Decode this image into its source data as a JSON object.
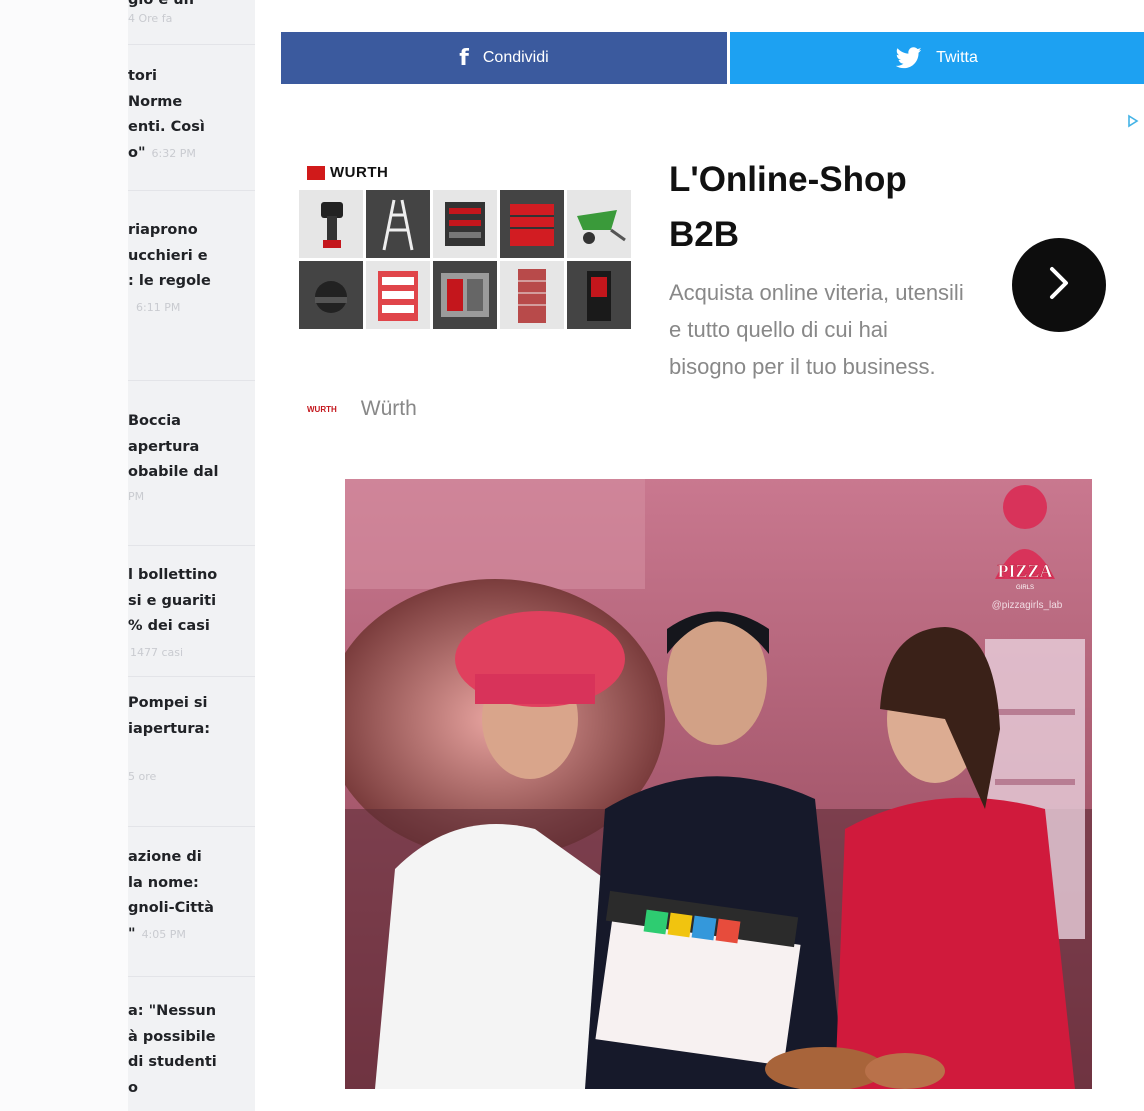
{
  "sidebar": {
    "items": [
      {
        "title": "gio e un",
        "time": "4 Ore fa"
      },
      {
        "title": "tori\nNorme\nenti. Così\no\"",
        "time": "6:32 PM"
      },
      {
        "title": "riaprono\nucchieri e\n: le regole",
        "time": "6:11 PM"
      },
      {
        "title": "Boccia\napertura\nobabile dal",
        "time": "PM"
      },
      {
        "title": "l bollettino\nsi e guariti\n% dei casi",
        "time": "1477 casi"
      },
      {
        "title": "Pompei si\niapertura:",
        "time": "5 ore"
      },
      {
        "title": "azione di\nla nome:\ngnoli-Città\n\"",
        "time": "4:05 PM"
      },
      {
        "title": "a: \"Nessun\nà possibile\ndi studenti\no",
        "time": ""
      }
    ]
  },
  "share": {
    "facebook_label": "Condividi",
    "twitter_label": "Twitta",
    "colors": {
      "facebook": "#3b5a9e",
      "twitter": "#1da1f2"
    }
  },
  "ad": {
    "brand_logo": "WURTH",
    "brand_small": "WURTH",
    "brand_name": "Würth",
    "title": "L'Online-Shop B2B",
    "description": "Acquista online viteria, utensili e tutto quello di cui hai bisogno per il tuo business.",
    "adchoice_icon": "adchoices-icon",
    "arrow_icon": "chevron-right-icon"
  },
  "photo": {
    "logo_text": "PIZZA",
    "logo_subtext": "GIRLS",
    "handle": "@pizzagirls_lab"
  }
}
